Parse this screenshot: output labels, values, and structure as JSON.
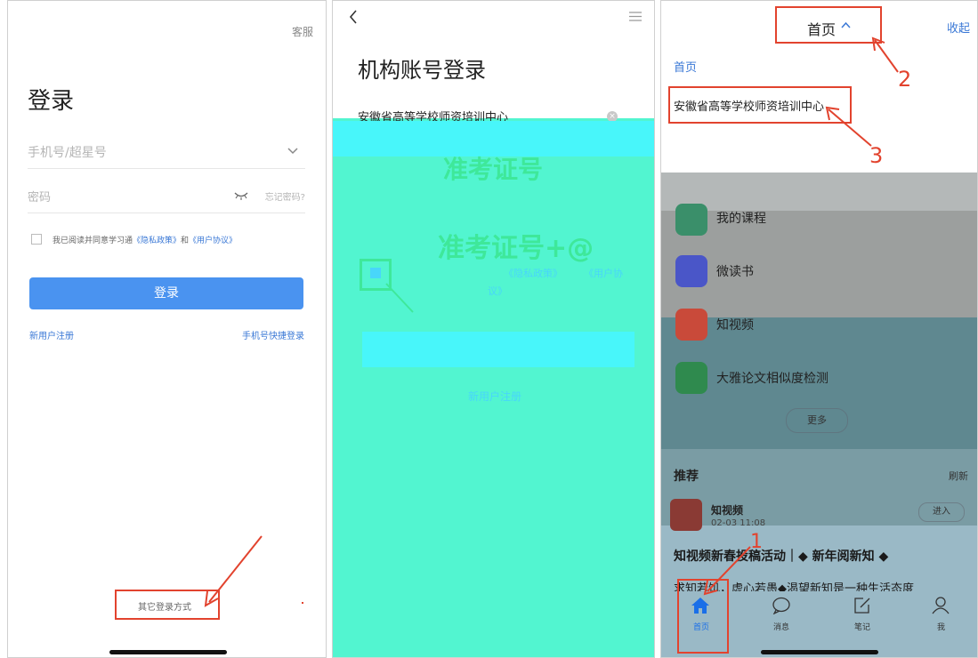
{
  "login": {
    "service": "客服",
    "title": "登录",
    "phone_placeholder": "手机号/超星号",
    "password_placeholder": "密码",
    "forgot_password": "忘记密码?",
    "agree_prefix": "我已阅读并同意学习通",
    "privacy": "《隐私政策》",
    "and": "和",
    "user_agreement": "《用户协议》",
    "login_button": "登录",
    "register": "新用户注册",
    "phone_quick_login": "手机号快捷登录",
    "other_login": "其它登录方式"
  },
  "institution": {
    "title": "机构账号登录",
    "org_name": "安徽省高等学校师资培训中心",
    "ticket_placeholder": "准考证号",
    "ticket_at": "准考证号+@",
    "privacy": "《隐私政策》",
    "user_agreement_fragment": "《用户协",
    "agreement_tail": "议》",
    "register": "新用户注册"
  },
  "home": {
    "title": "首页",
    "collapse": "收起",
    "breadcrumb": "首页",
    "org_item": "安徽省高等学校师资培训中心",
    "apps": [
      {
        "label": "我的课程",
        "icon": "graduation-cap-icon",
        "color": "#3a8f6a"
      },
      {
        "label": "微读书",
        "icon": "book-icon",
        "color": "#4a56c8"
      },
      {
        "label": "知视频",
        "icon": "video-icon",
        "color": "#c94a3a"
      },
      {
        "label": "大雅论文相似度检测",
        "icon": "leaf-icon",
        "color": "#2f8a4e"
      }
    ],
    "more": "更多",
    "recommend": "推荐",
    "refresh": "刷新",
    "feed_title": "知视频",
    "feed_sub": "02-03 11:08",
    "enter": "进入",
    "headline": "知视频新春投稿活动｜◆ 新年阅新知 ◆",
    "subline": "求知若饥，虚心若愚◆渴望新知是一种生活态度",
    "tabs": [
      {
        "label": "首页",
        "icon": "home-icon"
      },
      {
        "label": "消息",
        "icon": "chat-icon"
      },
      {
        "label": "笔记",
        "icon": "note-icon"
      },
      {
        "label": "我",
        "icon": "user-icon"
      }
    ]
  },
  "annotations": {
    "n1": "1",
    "n2": "2",
    "n3": "3"
  },
  "colors": {
    "annotation_red": "#e2432e",
    "primary_blue": "#4a93f0",
    "teal_bg": "#52f5d0",
    "cyan": "#48f6fa"
  }
}
